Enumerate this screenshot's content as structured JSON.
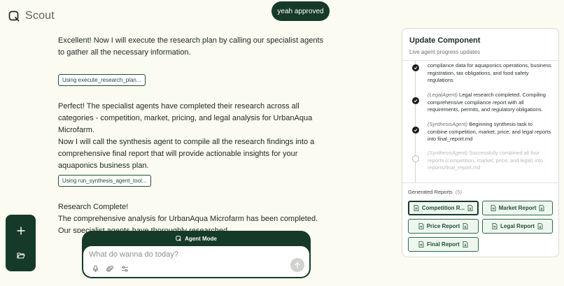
{
  "app": {
    "name": "Scout"
  },
  "user_message": "yeah approved",
  "chat": {
    "message_1": "Excellent! Now I will execute the research plan by calling our specialist agents to gather all the necessary information.",
    "tool_1": "Using execute_research_plan...",
    "message_2a": "Perfect! The specialist agents have completed their research across all categories - competition, market, pricing, and legal analysis for UrbanAqua Microfarm.",
    "message_2b": "Now I will call the synthesis agent to compile all the research findings into a comprehensive final report that will provide actionable insights for your aquaponics business plan.",
    "tool_2": "Using run_synthesis_agent_tool...",
    "message_3a": "Research Complete!",
    "message_3b": "The comprehensive analysis for UrbanAqua Microfarm has been completed. Our specialist agents have thoroughly researched"
  },
  "composer": {
    "mode_label": "Agent Mode",
    "placeholder": "What do wanna do today?"
  },
  "panel": {
    "title": "Update Component",
    "subtitle": "Live agent progress updates",
    "timeline": [
      {
        "agent": "",
        "text": "compliance data for aquaponics operations, business registration, tax obligations, and food safety regulations",
        "status": "done"
      },
      {
        "agent": "(LegalAgent)",
        "text": "Legal research completed. Compiling comprehensive compliance report with all requirements, permits, and regulatory obligations.",
        "status": "done"
      },
      {
        "agent": "(SynthesisAgent)",
        "text": "Beginning synthesis task to combine competition, market, price, and legal reports into final_report.md",
        "status": "done"
      },
      {
        "agent": "(SynthesisAgent)",
        "text": "Successfully combined all four reports (competition, market, price, and legal) into reports/final_report.md",
        "status": "pending"
      }
    ],
    "reports_label": "Generated Reports",
    "reports_count": "(5)",
    "reports": [
      {
        "label": "Competition R...",
        "selected": true
      },
      {
        "label": "Market Report",
        "selected": false
      },
      {
        "label": "Price Report",
        "selected": false
      },
      {
        "label": "Legal Report",
        "selected": false
      },
      {
        "label": "Final Report",
        "selected": false
      }
    ]
  },
  "colors": {
    "background": "#fbfbf1",
    "accent_dark": "#163a2a",
    "report_fill": "#eef7ee"
  },
  "icons": {
    "brand": "scout-logo-icon",
    "new_chat": "plus-icon",
    "files": "folder-open-icon",
    "mic": "mic-icon",
    "attach": "paperclip-icon",
    "settings": "sliders-icon",
    "send": "arrow-up-icon",
    "done": "check-icon",
    "pending": "spinner-icon",
    "report": "file-text-icon",
    "download": "file-download-icon"
  }
}
